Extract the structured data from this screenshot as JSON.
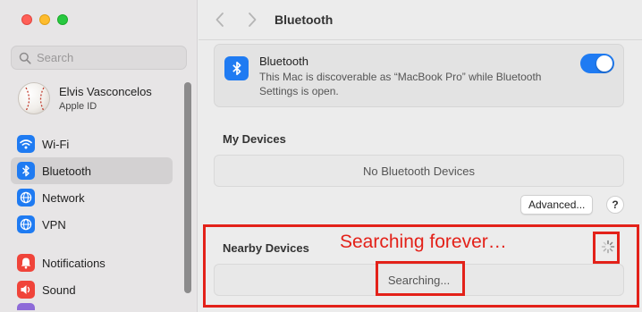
{
  "window": {
    "title": "Bluetooth"
  },
  "sidebar": {
    "search_placeholder": "Search",
    "profile": {
      "name": "Elvis Vasconcelos",
      "subtitle": "Apple ID"
    },
    "items": [
      {
        "label": "Wi-Fi",
        "icon": "wifi-icon",
        "color": "#1f7bf2",
        "active": false
      },
      {
        "label": "Bluetooth",
        "icon": "bluetooth-icon",
        "color": "#1f7bf2",
        "active": true
      },
      {
        "label": "Network",
        "icon": "globe-icon",
        "color": "#1f7bf2",
        "active": false
      },
      {
        "label": "VPN",
        "icon": "globe-icon",
        "color": "#1f7bf2",
        "active": false
      },
      {
        "label": "Notifications",
        "icon": "bell-icon",
        "color": "#f0443a",
        "active": false
      },
      {
        "label": "Sound",
        "icon": "speaker-icon",
        "color": "#f0443a",
        "active": false
      }
    ]
  },
  "main": {
    "bluetooth_card": {
      "title": "Bluetooth",
      "description": "This Mac is discoverable as “MacBook Pro” while Bluetooth Settings is open.",
      "toggle_on": true
    },
    "my_devices": {
      "title": "My Devices",
      "empty_text": "No Bluetooth Devices"
    },
    "advanced_button": "Advanced...",
    "help_button": "?",
    "nearby_devices": {
      "title": "Nearby Devices",
      "status_text": "Searching..."
    }
  },
  "annotation": {
    "text": "Searching forever…",
    "color": "#e32119"
  }
}
